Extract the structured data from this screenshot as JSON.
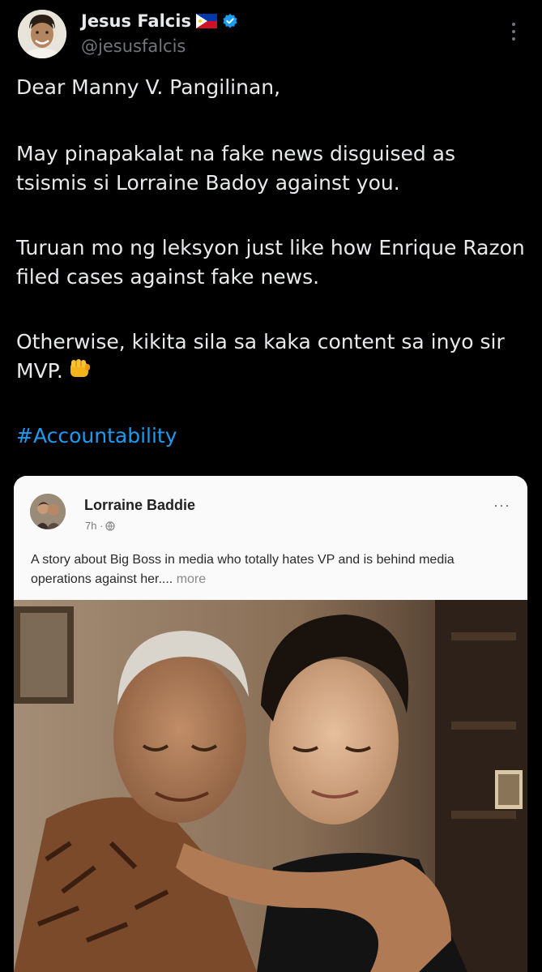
{
  "author": {
    "display_name": "Jesus Falcis",
    "handle": "@jesusfalcis",
    "flag_icon": "philippines-flag-icon",
    "verified_icon": "verified-badge-icon",
    "verified_color": "#1d9bf0"
  },
  "tweet": {
    "paragraphs": [
      "Dear Manny V. Pangilinan,",
      "May pinapakalat na fake news disguised as tsismis si Lorraine Badoy against you.",
      "Turuan mo ng leksyon just like how Enrique Razon filed cases against fake news.",
      "Otherwise, kikita sila sa kaka content sa inyo sir MVP."
    ],
    "emoji_icon": "oncoming-fist-icon",
    "hashtag": "#Accountability",
    "hashtag_color": "#1d9bf0"
  },
  "embedded_post": {
    "author_name": "Lorraine Baddie",
    "time": "7h",
    "caption": "A story about Big Boss in media who totally hates VP and is behind media operations against her....",
    "more_label": "more",
    "options_label": "···"
  }
}
